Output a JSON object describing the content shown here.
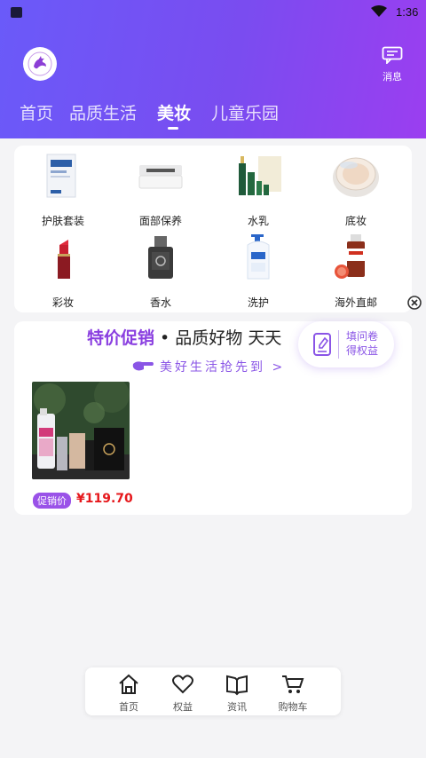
{
  "status_bar": {
    "time": "1:36"
  },
  "header": {
    "message_label": "消息",
    "tabs": [
      {
        "label": "首页"
      },
      {
        "label": "品质生活"
      },
      {
        "label": "美妆"
      },
      {
        "label": "儿童乐园"
      }
    ]
  },
  "categories": [
    {
      "label": "护肤套装",
      "icon": "skincare-set-image"
    },
    {
      "label": "面部保养",
      "icon": "face-cream-image"
    },
    {
      "label": "水乳",
      "icon": "lotion-image"
    },
    {
      "label": "底妆",
      "icon": "cushion-foundation-image"
    },
    {
      "label": "彩妆",
      "icon": "lipstick-image"
    },
    {
      "label": "香水",
      "icon": "perfume-image"
    },
    {
      "label": "洗护",
      "icon": "body-wash-image"
    },
    {
      "label": "海外直邮",
      "icon": "overseas-bottle-image"
    }
  ],
  "promo": {
    "title_highlight": "特价促销",
    "title_rest": " • 品质好物 天天",
    "subtitle": "美好生活抢先到 >",
    "product": {
      "price_tag": "促销价",
      "price": "¥119.70"
    }
  },
  "survey": {
    "line1": "填问卷",
    "line2": "得权益"
  },
  "bottom_nav": [
    {
      "label": "首页",
      "icon": "home-icon"
    },
    {
      "label": "权益",
      "icon": "heart-icon"
    },
    {
      "label": "资讯",
      "icon": "book-icon"
    },
    {
      "label": "购物车",
      "icon": "cart-icon"
    }
  ],
  "colors": {
    "header_start": "#6a5af9",
    "header_end": "#9b3ef0",
    "accent": "#8a3fe0",
    "price": "#e6181c"
  }
}
